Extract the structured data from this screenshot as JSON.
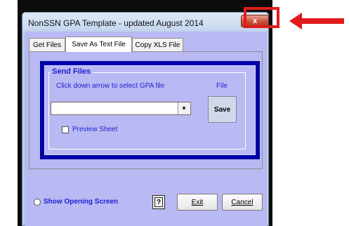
{
  "window": {
    "title": "NonSSN GPA Template - updated August 2014",
    "close_glyph": "x"
  },
  "tabs": [
    {
      "label": "Get Files"
    },
    {
      "label": "Save As Text File"
    },
    {
      "label": "Copy XLS File"
    }
  ],
  "active_tab": "Save As Text File",
  "send_files": {
    "group_title": "Send Files",
    "instruction": "Click down arrow to select GPA file",
    "file_label": "File",
    "combo_value": "",
    "save_label": "Save",
    "preview_label": "Preview Sheet",
    "preview_checked": false
  },
  "footer": {
    "show_opening_label": "Show Opening Screen",
    "help_glyph": "?",
    "exit_label": "Exit",
    "cancel_label": "Cancel"
  },
  "colors": {
    "annotation": "#e11b1b",
    "panel": "#b9b9f3",
    "navy_frame": "#0000a8",
    "label_blue": "#1f1fd1"
  },
  "icons": [
    "close-icon",
    "dropdown-arrow-icon",
    "help-icon",
    "arrow-annotation-icon"
  ]
}
